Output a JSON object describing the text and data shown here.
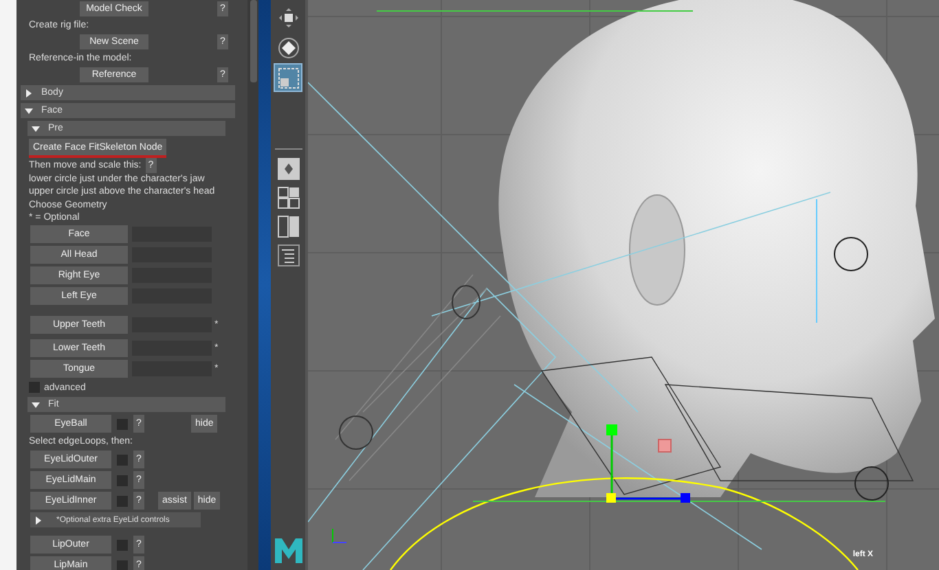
{
  "panel": {
    "items": [
      {
        "kind": "button",
        "label": "Model Check",
        "help": "?"
      },
      {
        "kind": "text",
        "text": "Create rig file:"
      },
      {
        "kind": "button",
        "label": "New Scene",
        "help": "?"
      },
      {
        "kind": "text",
        "text": "Reference-in the model:"
      },
      {
        "kind": "button",
        "label": "Reference",
        "help": "?"
      },
      {
        "kind": "section",
        "label": "Body",
        "expanded": false
      },
      {
        "kind": "section",
        "label": "Face",
        "expanded": true
      },
      {
        "kind": "subsection",
        "label": "Pre",
        "expanded": true
      },
      {
        "kind": "action",
        "label": "Create Face FitSkeleton Node"
      },
      {
        "kind": "text",
        "text": "Then move and scale this:",
        "help": "?"
      },
      {
        "kind": "text",
        "text": "lower circle just under the character's jaw"
      },
      {
        "kind": "text",
        "text": "upper circle just above the character's head"
      },
      {
        "kind": "text",
        "text": "Choose Geometry"
      },
      {
        "kind": "text",
        "text": "* = Optional"
      },
      {
        "kind": "geometry",
        "label": "Face",
        "separated": false
      },
      {
        "kind": "geometry",
        "label": "All Head",
        "separated": false
      },
      {
        "kind": "geometry",
        "label": "Right Eye",
        "separated": false
      },
      {
        "kind": "geometry",
        "label": "Left Eye",
        "separated": false
      },
      {
        "kind": "geometry",
        "label": "Upper Teeth",
        "marker": "*",
        "separated": true
      },
      {
        "kind": "geometry",
        "label": "Lower Teeth",
        "marker": "*",
        "separated": false
      },
      {
        "kind": "geometry",
        "label": "Tongue",
        "marker": "*",
        "separated": false
      },
      {
        "kind": "checkbox",
        "label": "advanced",
        "checked": false
      },
      {
        "kind": "subsection",
        "label": "Fit",
        "expanded": true
      },
      {
        "kind": "fit",
        "label": "EyeBall",
        "checked": false,
        "help": "?",
        "extras": [
          "hide"
        ]
      },
      {
        "kind": "text",
        "text": "Select edgeLoops, then:"
      },
      {
        "kind": "fit",
        "label": "EyeLidOuter",
        "checked": false,
        "help": "?"
      },
      {
        "kind": "fit",
        "label": "EyeLidMain",
        "checked": false,
        "help": "?"
      },
      {
        "kind": "fit",
        "label": "EyeLidInner",
        "checked": false,
        "help": "?",
        "extras": [
          "assist",
          "hide"
        ]
      },
      {
        "kind": "note",
        "label": "*Optional extra EyeLid controls",
        "expanded": false
      },
      {
        "kind": "fit",
        "label": "LipOuter",
        "checked": false,
        "help": "?"
      },
      {
        "kind": "fit",
        "label": "LipMain",
        "checked": false,
        "help": "?"
      }
    ]
  },
  "toolbar": {
    "tools": [
      {
        "selected": false
      },
      {
        "selected": false
      },
      {
        "selected": true
      }
    ]
  },
  "viewport": {
    "label": "left X"
  }
}
